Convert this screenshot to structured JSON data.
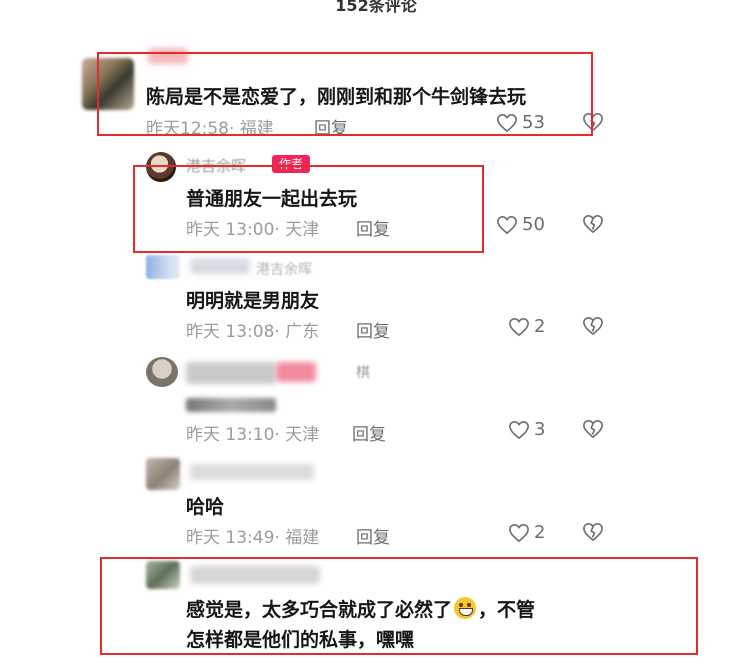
{
  "header": {
    "comment_count": "152条评论"
  },
  "comments": [
    {
      "text": "陈局是不是恋爱了，刚刚到和那个牛剑锋去玩",
      "time": "昨天12:58",
      "location": "· 福建",
      "reply": "回复",
      "likes": "53"
    },
    {
      "author": "港吉余晖",
      "badge": "作者",
      "text": "普通朋友一起出去玩",
      "time": "昨天 13:00",
      "location": "· 天津",
      "reply": "回复",
      "likes": "50"
    },
    {
      "author": "港吉余晖",
      "text": "明明就是男朋友",
      "time": "昨天 13:08",
      "location": "· 广东",
      "reply": "回复",
      "likes": "2"
    },
    {
      "author": "棋",
      "text": "",
      "time": "昨天 13:10",
      "location": "· 天津",
      "reply": "回复",
      "likes": "3"
    },
    {
      "text": "哈哈",
      "time": "昨天 13:49",
      "location": "· 福建",
      "reply": "回复",
      "likes": "2"
    },
    {
      "text_line1_a": "感觉是，太多巧合就成了必然了",
      "text_line1_b": "，不管",
      "text_line2": "怎样都是他们的私事，嘿嘿"
    }
  ],
  "icons": {
    "like": "heart-outline-icon",
    "dislike": "broken-heart-icon",
    "emoji": "grinning-face-icon"
  },
  "colors": {
    "highlight_box": "#e52b2b",
    "author_badge": "#f1245a"
  }
}
